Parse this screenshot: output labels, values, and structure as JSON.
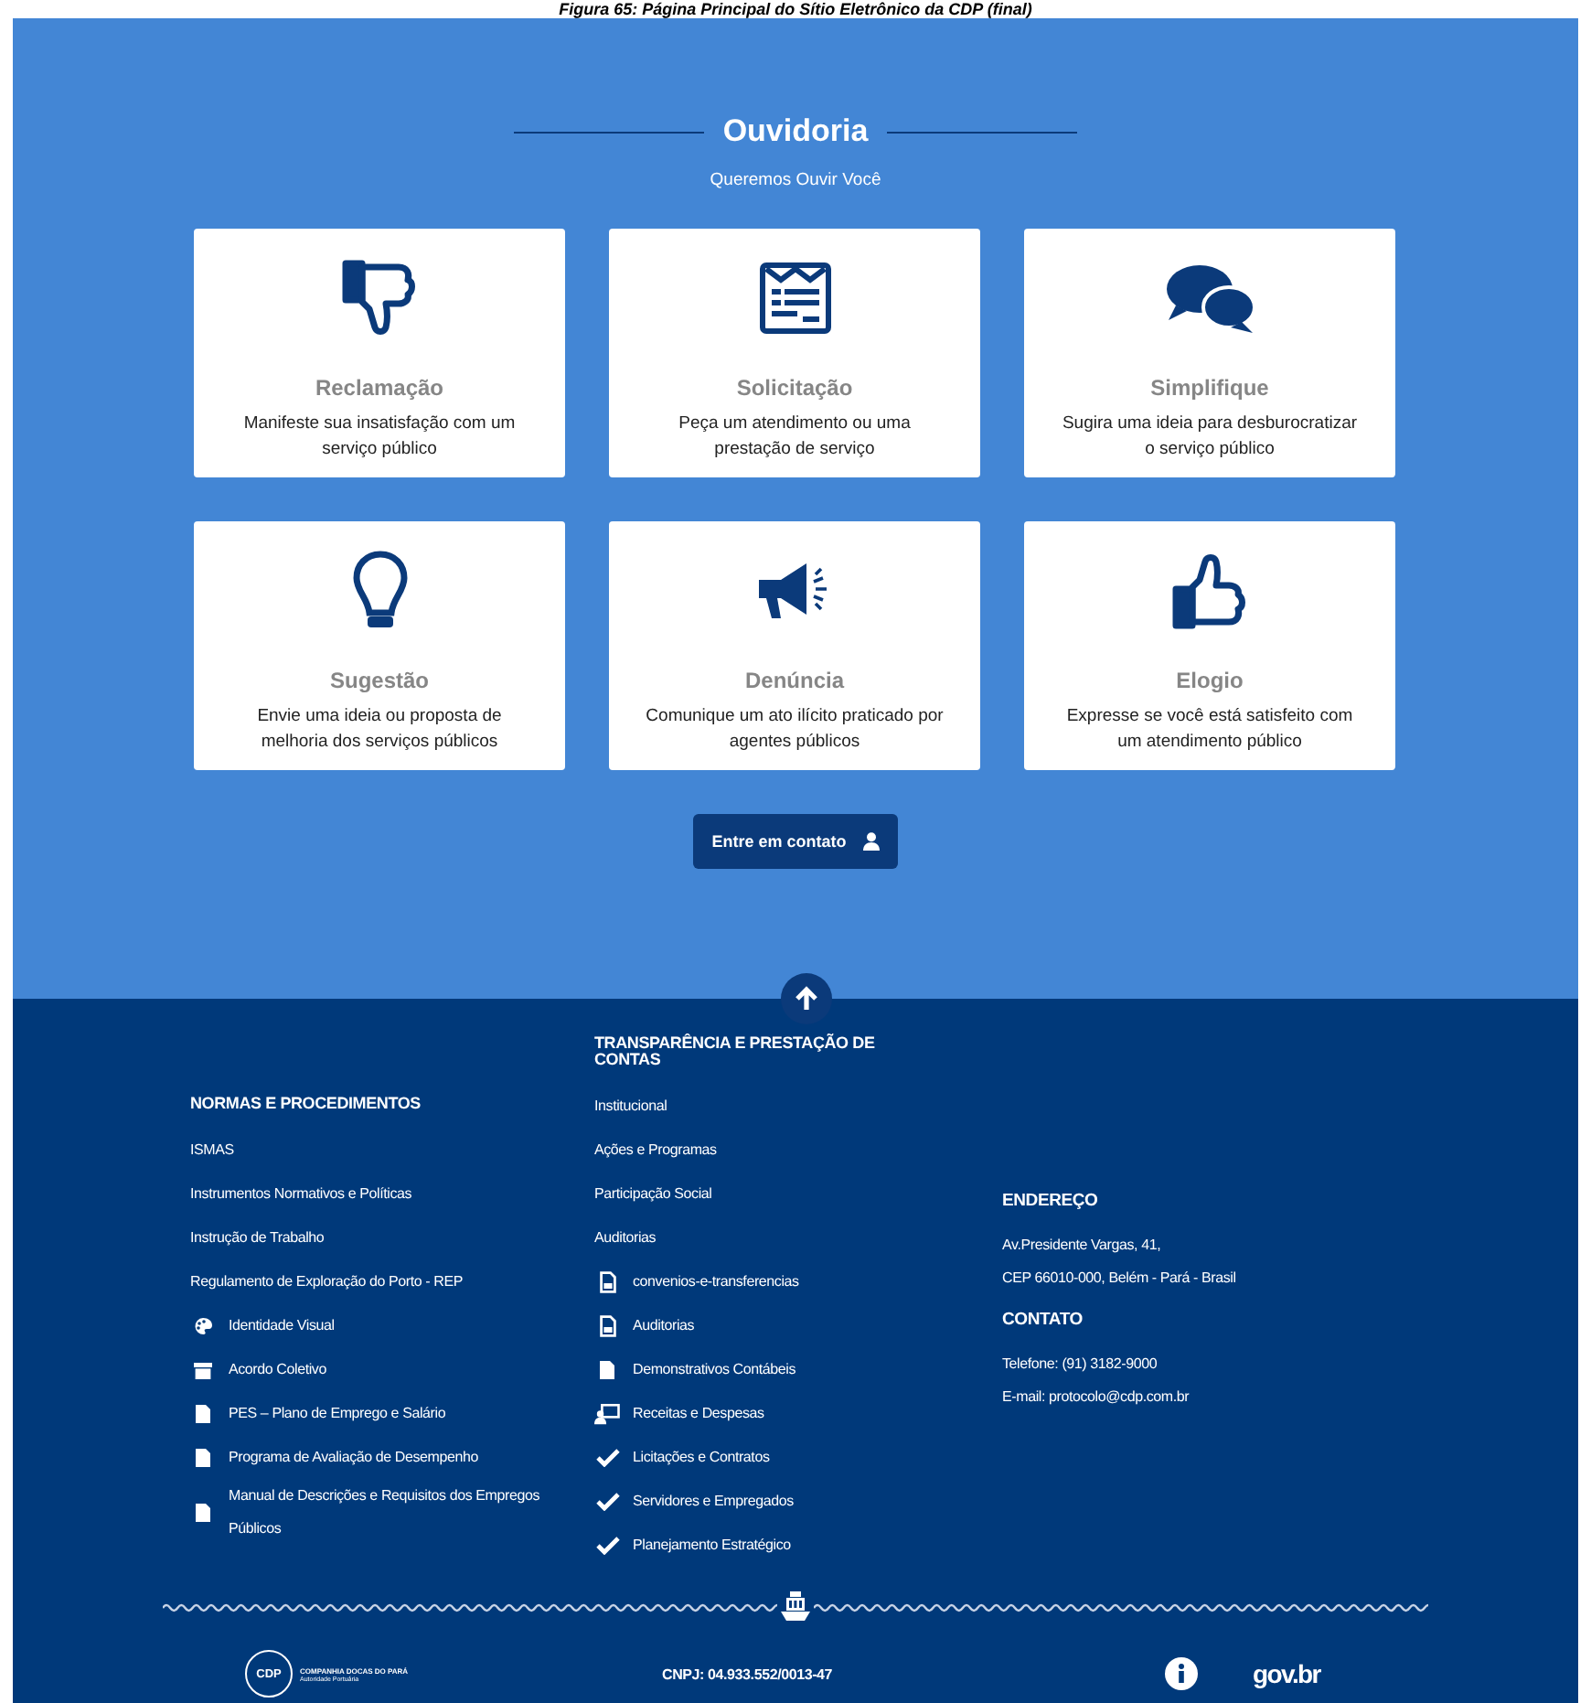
{
  "caption": "Figura 65: Página Principal do Sítio Eletrônico da CDP (final)",
  "ouvidoria": {
    "title": "Ouvidoria",
    "subtitle": "Queremos Ouvir Você",
    "cards": [
      {
        "title": "Reclamação",
        "text": "Manifeste sua insatisfação com um serviço público"
      },
      {
        "title": "Solicitação",
        "text": "Peça um atendimento ou uma prestação de serviço"
      },
      {
        "title": "Simplifique",
        "text": "Sugira uma ideia para desburocratizar o serviço público"
      },
      {
        "title": "Sugestão",
        "text": "Envie uma ideia ou proposta de melhoria dos serviços públicos"
      },
      {
        "title": "Denúncia",
        "text": "Comunique um ato ilícito praticado por agentes públicos"
      },
      {
        "title": "Elogio",
        "text": "Expresse se você está satisfeito com um atendimento público"
      }
    ],
    "contact_button": "Entre em contato"
  },
  "footer": {
    "normas": {
      "heading": "NORMAS E PROCEDIMENTOS",
      "items": [
        {
          "label": "ISMAS",
          "kind": "plain"
        },
        {
          "label": "Instrumentos Normativos e Políticas",
          "kind": "plain"
        },
        {
          "label": "Instrução de Trabalho",
          "kind": "plain"
        },
        {
          "label": "Regulamento de Exploração do Porto - REP",
          "kind": "plain"
        },
        {
          "label": "Identidade Visual",
          "kind": "palette"
        },
        {
          "label": "Acordo Coletivo",
          "kind": "archive"
        },
        {
          "label": "PES – Plano de Emprego e Salário",
          "kind": "file"
        },
        {
          "label": "Programa de Avaliação de Desempenho",
          "kind": "file"
        },
        {
          "label": "Manual de Descrições e Requisitos dos Empregos Públicos",
          "kind": "file"
        }
      ]
    },
    "transparencia": {
      "heading": "TRANSPARÊNCIA E PRESTAÇÃO DE CONTAS",
      "items": [
        {
          "label": "Institucional",
          "kind": "plain"
        },
        {
          "label": "Ações e Programas",
          "kind": "plain"
        },
        {
          "label": "Participação Social",
          "kind": "plain"
        },
        {
          "label": "Auditorias",
          "kind": "plain"
        },
        {
          "label": "convenios-e-transferencias",
          "kind": "document"
        },
        {
          "label": "Auditorias",
          "kind": "document"
        },
        {
          "label": "Demonstrativos Contábeis",
          "kind": "file"
        },
        {
          "label": "Receitas e Despesas",
          "kind": "screen"
        },
        {
          "label": "Licitações e Contratos",
          "kind": "check"
        },
        {
          "label": "Servidores e Empregados",
          "kind": "check"
        },
        {
          "label": "Planejamento Estratégico",
          "kind": "check"
        }
      ]
    },
    "endereco": {
      "heading": "ENDEREÇO",
      "lines": [
        "Av.Presidente Vargas, 41,",
        "CEP 66010-000, Belém - Pará - Brasil"
      ]
    },
    "contato": {
      "heading": "CONTATO",
      "lines": [
        "Telefone: (91) 3182-9000",
        "E-mail: protocolo@cdp.com.br"
      ]
    },
    "logo": {
      "mark": "CDP",
      "name": "COMPANHIA DOCAS DO PARÁ",
      "tagline": "Autoridade Portuária"
    },
    "cnpj": "CNPJ: 04.933.552/0013-47",
    "govbr": "gov.br"
  }
}
